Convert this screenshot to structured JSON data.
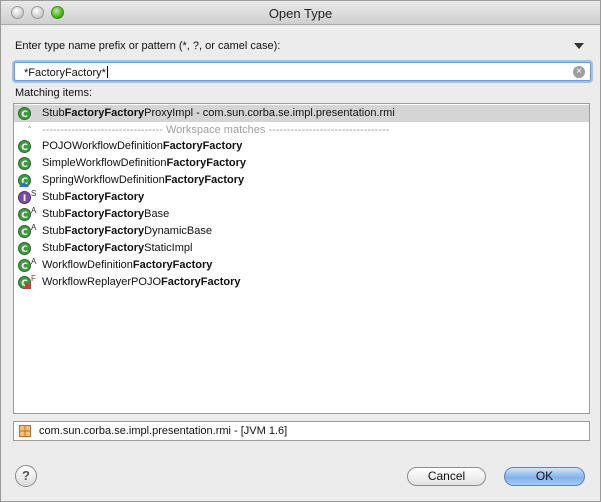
{
  "window": {
    "title": "Open Type"
  },
  "prompt": "Enter type name prefix or pattern (*, ?, or camel case):",
  "search": {
    "value": "*FactoryFactory*"
  },
  "matching_label": "Matching items:",
  "history_item": {
    "parts": [
      {
        "t": "Stub",
        "b": false
      },
      {
        "t": "FactoryFactory",
        "b": true
      },
      {
        "t": "ProxyImpl - com.sun.corba.se.impl.presentation.rmi",
        "b": false
      }
    ],
    "icon": "class-icon"
  },
  "separator": "--------------------------------- Workspace matches ---------------------------------",
  "items": [
    {
      "icon": "class-icon",
      "badge": "",
      "parts": [
        {
          "t": "POJOWorkflowDefinition",
          "b": false
        },
        {
          "t": "FactoryFactory",
          "b": true
        }
      ]
    },
    {
      "icon": "class-icon",
      "badge": "",
      "parts": [
        {
          "t": "SimpleWorkflowDefinition",
          "b": false
        },
        {
          "t": "FactoryFactory",
          "b": true
        }
      ]
    },
    {
      "icon": "class-protected-icon",
      "badge": "",
      "parts": [
        {
          "t": "SpringWorkflowDefinition",
          "b": false
        },
        {
          "t": "FactoryFactory",
          "b": true
        }
      ]
    },
    {
      "icon": "interface-icon",
      "badge": "S",
      "parts": [
        {
          "t": "Stub",
          "b": false
        },
        {
          "t": "FactoryFactory",
          "b": true
        }
      ]
    },
    {
      "icon": "class-icon",
      "badge": "A",
      "parts": [
        {
          "t": "Stub",
          "b": false
        },
        {
          "t": "FactoryFactory",
          "b": true
        },
        {
          "t": "Base",
          "b": false
        }
      ]
    },
    {
      "icon": "class-icon",
      "badge": "A",
      "parts": [
        {
          "t": "Stub",
          "b": false
        },
        {
          "t": "FactoryFactory",
          "b": true
        },
        {
          "t": "DynamicBase",
          "b": false
        }
      ]
    },
    {
      "icon": "class-icon",
      "badge": "",
      "parts": [
        {
          "t": "Stub",
          "b": false
        },
        {
          "t": "FactoryFactory",
          "b": true
        },
        {
          "t": "StaticImpl",
          "b": false
        }
      ]
    },
    {
      "icon": "class-icon",
      "badge": "A",
      "parts": [
        {
          "t": "WorkflowDefinition",
          "b": false
        },
        {
          "t": "FactoryFactory",
          "b": true
        }
      ]
    },
    {
      "icon": "class-private-icon",
      "badge": "F",
      "parts": [
        {
          "t": "WorkflowReplayerPOJO",
          "b": false
        },
        {
          "t": "FactoryFactory",
          "b": true
        }
      ]
    }
  ],
  "status": {
    "text": "com.sun.corba.se.impl.presentation.rmi - [JVM 1.6]",
    "icon": "package-icon"
  },
  "buttons": {
    "help": "?",
    "cancel": "Cancel",
    "ok": "OK"
  },
  "colors": {
    "class_icon": "#3f9b3f",
    "interface_icon": "#7b4ba8",
    "ok_button": "#7fb2eb"
  }
}
